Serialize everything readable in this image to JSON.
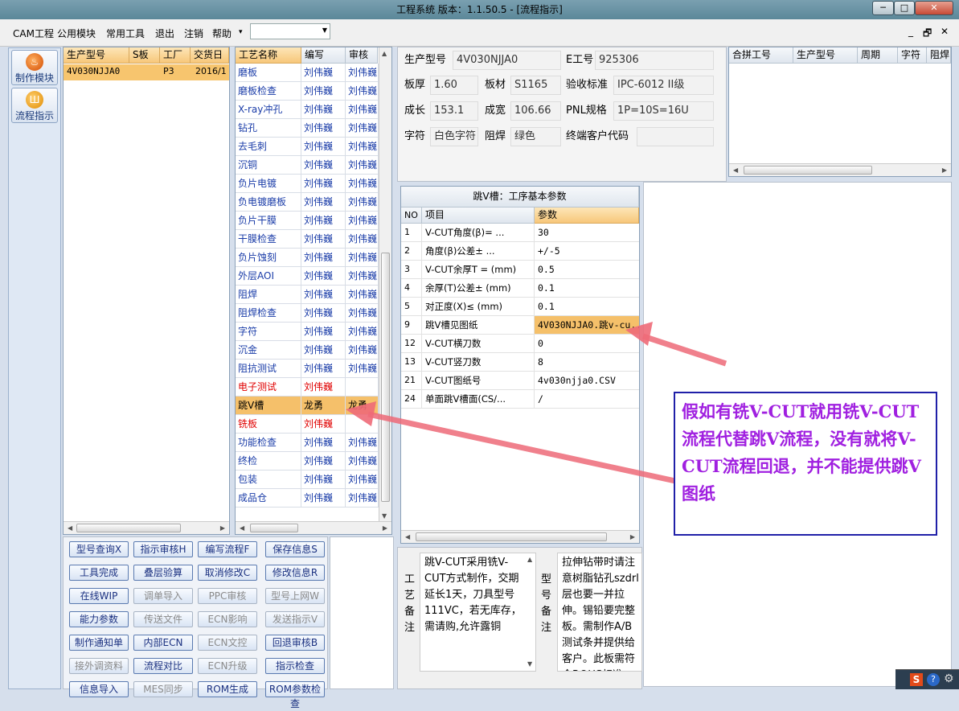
{
  "window": {
    "title": "工程系统  版本：1.1.50.5 - [流程指示]",
    "min": "─",
    "max": "□",
    "close": "✕"
  },
  "menu": {
    "items": [
      "CAM工程",
      "公用模块",
      "常用工具",
      "退出",
      "注销",
      "帮助"
    ],
    "help_arrow": "▾",
    "combo_value": "",
    "mdi": [
      "_",
      "🗗",
      "✕"
    ]
  },
  "nav": {
    "items": [
      {
        "label": "制作模块",
        "icon": "flame-icon",
        "glyph": "♨"
      },
      {
        "label": "流程指示",
        "icon": "flow-icon",
        "glyph": "Ш"
      }
    ]
  },
  "order_grid": {
    "columns": [
      "生产型号",
      "S板",
      "工厂",
      "交货日"
    ],
    "rows": [
      {
        "model": "4V030NJJA0",
        "s": "",
        "factory": "P3",
        "date": "2016/1"
      }
    ]
  },
  "process_grid": {
    "columns": [
      "工艺名称",
      "编写",
      "审核"
    ],
    "rows": [
      {
        "name": "磨板",
        "writer": "刘伟巍",
        "reviewer": "刘伟巍",
        "style": "blue"
      },
      {
        "name": "磨板检查",
        "writer": "刘伟巍",
        "reviewer": "刘伟巍",
        "style": "blue"
      },
      {
        "name": "X-ray冲孔",
        "writer": "刘伟巍",
        "reviewer": "刘伟巍",
        "style": "blue"
      },
      {
        "name": "钻孔",
        "writer": "刘伟巍",
        "reviewer": "刘伟巍",
        "style": "blue"
      },
      {
        "name": "去毛刺",
        "writer": "刘伟巍",
        "reviewer": "刘伟巍",
        "style": "blue"
      },
      {
        "name": "沉铜",
        "writer": "刘伟巍",
        "reviewer": "刘伟巍",
        "style": "blue"
      },
      {
        "name": "负片电镀",
        "writer": "刘伟巍",
        "reviewer": "刘伟巍",
        "style": "blue"
      },
      {
        "name": "负电镀磨板",
        "writer": "刘伟巍",
        "reviewer": "刘伟巍",
        "style": "blue"
      },
      {
        "name": "负片干膜",
        "writer": "刘伟巍",
        "reviewer": "刘伟巍",
        "style": "blue"
      },
      {
        "name": "干膜检查",
        "writer": "刘伟巍",
        "reviewer": "刘伟巍",
        "style": "blue"
      },
      {
        "name": "负片蚀刻",
        "writer": "刘伟巍",
        "reviewer": "刘伟巍",
        "style": "blue"
      },
      {
        "name": "外层AOI",
        "writer": "刘伟巍",
        "reviewer": "刘伟巍",
        "style": "blue"
      },
      {
        "name": "阻焊",
        "writer": "刘伟巍",
        "reviewer": "刘伟巍",
        "style": "blue"
      },
      {
        "name": "阻焊检查",
        "writer": "刘伟巍",
        "reviewer": "刘伟巍",
        "style": "blue"
      },
      {
        "name": "字符",
        "writer": "刘伟巍",
        "reviewer": "刘伟巍",
        "style": "blue"
      },
      {
        "name": "沉金",
        "writer": "刘伟巍",
        "reviewer": "刘伟巍",
        "style": "blue"
      },
      {
        "name": "阻抗测试",
        "writer": "刘伟巍",
        "reviewer": "刘伟巍",
        "style": "blue"
      },
      {
        "name": "电子测试",
        "writer": "刘伟巍",
        "reviewer": "",
        "style": "red"
      },
      {
        "name": "跳V槽",
        "writer": "龙勇",
        "reviewer": "龙勇",
        "style": "sel"
      },
      {
        "name": "铣板",
        "writer": "刘伟巍",
        "reviewer": "",
        "style": "red"
      },
      {
        "name": "功能检查",
        "writer": "刘伟巍",
        "reviewer": "刘伟巍",
        "style": "blue"
      },
      {
        "name": "终检",
        "writer": "刘伟巍",
        "reviewer": "刘伟巍",
        "style": "blue"
      },
      {
        "name": "包装",
        "writer": "刘伟巍",
        "reviewer": "刘伟巍",
        "style": "blue"
      },
      {
        "name": "成品仓",
        "writer": "刘伟巍",
        "reviewer": "刘伟巍",
        "style": "blue"
      }
    ]
  },
  "info": {
    "model_label": "生产型号",
    "model": "4V030NJJA0",
    "eno_label": "E工号",
    "eno": "925306",
    "thick_label": "板厚",
    "thick": "1.60",
    "mat_label": "板材",
    "mat": "S1165",
    "std_label": "验收标准",
    "std": "IPC-6012 II级",
    "len_label": "成长",
    "len": "153.1",
    "wid_label": "成宽",
    "wid": "106.66",
    "pnl_label": "PNL规格",
    "pnl": "1P=10S=16U",
    "char_label": "字符",
    "char": "白色字符",
    "mask_label": "阻焊",
    "mask": "绿色",
    "cust_label": "终端客户代码",
    "cust": ""
  },
  "merge_grid": {
    "columns": [
      "合拼工号",
      "生产型号",
      "周期",
      "字符",
      "阻焊"
    ]
  },
  "params": {
    "title": "跳V槽：工序基本参数",
    "columns": [
      "NO",
      "项目",
      "参数"
    ],
    "rows": [
      {
        "no": "1",
        "item": "V-CUT角度(β)=  ...",
        "value": "30"
      },
      {
        "no": "2",
        "item": "角度(β)公差±  ...",
        "value": "+/-5"
      },
      {
        "no": "3",
        "item": "V-CUT余厚T =  (mm)",
        "value": "0.5"
      },
      {
        "no": "4",
        "item": "余厚(T)公差±  (mm)",
        "value": "0.1"
      },
      {
        "no": "5",
        "item": "对正度(X)≤ (mm)",
        "value": "0.1"
      },
      {
        "no": "9",
        "item": "跳V槽见图纸",
        "value": "4V030NJJA0.跳v-cu..."
      },
      {
        "no": "12",
        "item": "V-CUT横刀数",
        "value": "0"
      },
      {
        "no": "13",
        "item": "V-CUT竖刀数",
        "value": "8"
      },
      {
        "no": "21",
        "item": "V-CUT图纸号",
        "value": "4v030njja0.CSV"
      },
      {
        "no": "24",
        "item": "单面跳V槽面(CS/...",
        "value": "/"
      }
    ]
  },
  "buttons": [
    {
      "label": "型号查询X",
      "enabled": true
    },
    {
      "label": "指示审核H",
      "enabled": true
    },
    {
      "label": "编写流程F",
      "enabled": true
    },
    {
      "label": "保存信息S",
      "enabled": true
    },
    {
      "label": "工具完成",
      "enabled": true
    },
    {
      "label": "叠层验算",
      "enabled": true
    },
    {
      "label": "取消修改C",
      "enabled": true
    },
    {
      "label": "修改信息R",
      "enabled": true
    },
    {
      "label": "在线WIP",
      "enabled": true
    },
    {
      "label": "调单导入",
      "enabled": false
    },
    {
      "label": "PPC审核",
      "enabled": false
    },
    {
      "label": "型号上网W",
      "enabled": false
    },
    {
      "label": "能力参数",
      "enabled": true
    },
    {
      "label": "传送文件",
      "enabled": false
    },
    {
      "label": "ECN影响",
      "enabled": false
    },
    {
      "label": "发送指示V",
      "enabled": false
    },
    {
      "label": "制作通知单",
      "enabled": true
    },
    {
      "label": "内部ECN",
      "enabled": true
    },
    {
      "label": "ECN文控",
      "enabled": false
    },
    {
      "label": "回退审核B",
      "enabled": true
    },
    {
      "label": "接外调资料",
      "enabled": false
    },
    {
      "label": "流程对比",
      "enabled": true
    },
    {
      "label": "ECN升级",
      "enabled": false
    },
    {
      "label": "指示检查",
      "enabled": true
    },
    {
      "label": "信息导入",
      "enabled": true
    },
    {
      "label": "MES同步",
      "enabled": false
    },
    {
      "label": "ROM生成",
      "enabled": true
    },
    {
      "label": "ROM参数检查",
      "enabled": true
    }
  ],
  "notes": {
    "process_label": [
      "工",
      "艺",
      "备",
      "注"
    ],
    "process_text": "跳V-CUT采用铣V-CUT方式制作，交期延长1天，刀具型号111VC，若无库存，需请购,允许露铜",
    "model_label": [
      "型",
      "号",
      "备",
      "注"
    ],
    "model_text": "拉伸钻带时请注意树脂钻孔szdrl层也要一并拉伸。锡铅要完整板。需制作A/B测试条并提供给客户。此板需符合ROHS标准。"
  },
  "annotation": {
    "text": "假如有铣V-CUT就用铣V-CUT流程代替跳V流程，没有就将V-CUT流程回退，并不能提供跳V图纸",
    "color": "#a020e0",
    "arrow_color": "#ee6a78"
  },
  "tray": {
    "s": "S",
    "help": "?",
    "gear": "⚙"
  }
}
